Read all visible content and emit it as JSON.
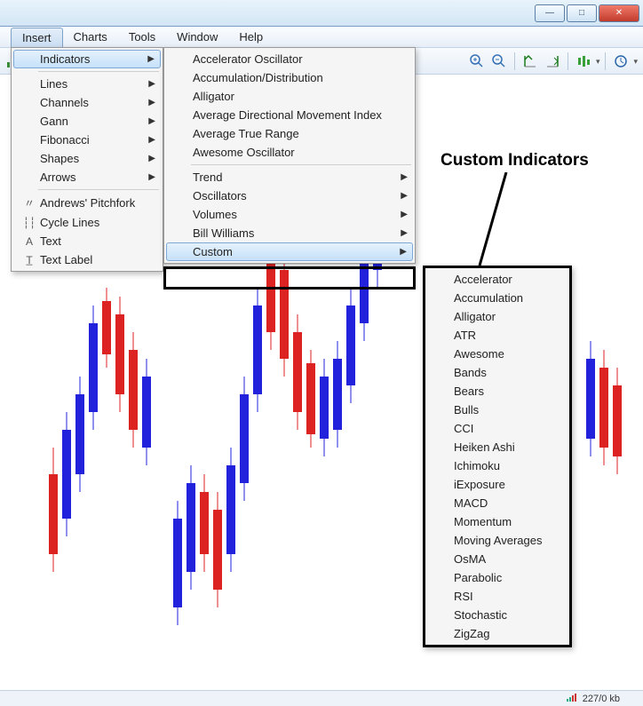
{
  "window": {
    "minimize": "—",
    "maximize": "□",
    "close": "✕"
  },
  "child_controls": {
    "minimize": "–",
    "restore": "❐",
    "close": "×"
  },
  "menubar": {
    "items": [
      "Insert",
      "Charts",
      "Tools",
      "Window",
      "Help"
    ]
  },
  "toolbar_right": {
    "zoom_in": "zoom-in",
    "zoom_out": "zoom-out"
  },
  "insert_menu": {
    "indicators": "Indicators",
    "lines": "Lines",
    "channels": "Channels",
    "gann": "Gann",
    "fibonacci": "Fibonacci",
    "shapes": "Shapes",
    "arrows": "Arrows",
    "andrews": "Andrews' Pitchfork",
    "cycle": "Cycle Lines",
    "text": "Text",
    "textlabel": "Text Label"
  },
  "indicators_submenu": {
    "accel": "Accelerator Oscillator",
    "accum": "Accumulation/Distribution",
    "alligator": "Alligator",
    "adx": "Average Directional Movement Index",
    "atr": "Average True Range",
    "awesome": "Awesome Oscillator",
    "trend": "Trend",
    "oscillators": "Oscillators",
    "volumes": "Volumes",
    "billwilliams": "Bill Williams",
    "custom": "Custom"
  },
  "custom_submenu": {
    "items": [
      "Accelerator",
      "Accumulation",
      "Alligator",
      "ATR",
      "Awesome",
      "Bands",
      "Bears",
      "Bulls",
      "CCI",
      "Heiken Ashi",
      "Ichimoku",
      "iExposure",
      "MACD",
      "Momentum",
      "Moving Averages",
      "OsMA",
      "Parabolic",
      "RSI",
      "Stochastic",
      "ZigZag"
    ]
  },
  "annotation": "Custom Indicators",
  "status": {
    "net": "227/0 kb"
  }
}
